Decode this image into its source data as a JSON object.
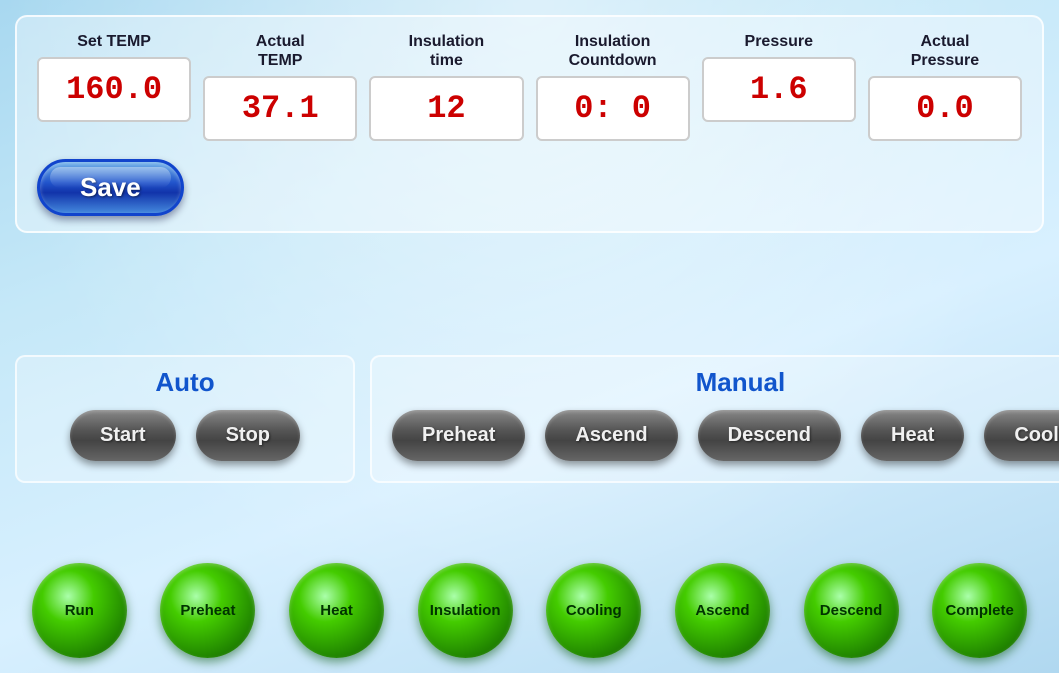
{
  "top_panel": {
    "fields": [
      {
        "label": "Set TEMP",
        "value": "160.0",
        "id": "set-temp"
      },
      {
        "label": "Actual\nTEMP",
        "value": "37.1",
        "id": "actual-temp"
      },
      {
        "label": "Insulation\ntime",
        "value": "12",
        "id": "insulation-time"
      },
      {
        "label": "Insulation\nCountdown",
        "value": "0:  0",
        "id": "insulation-countdown"
      },
      {
        "label": "Pressure",
        "value": "1.6",
        "id": "pressure"
      },
      {
        "label": "Actual\nPressure",
        "value": "0.0",
        "id": "actual-pressure"
      }
    ],
    "save_label": "Save"
  },
  "auto_panel": {
    "title": "Auto",
    "buttons": [
      {
        "label": "Start",
        "id": "start-btn"
      },
      {
        "label": "Stop",
        "id": "stop-btn"
      }
    ]
  },
  "manual_panel": {
    "title": "Manual",
    "buttons": [
      {
        "label": "Preheat",
        "id": "preheat-btn"
      },
      {
        "label": "Ascend",
        "id": "ascend-btn"
      },
      {
        "label": "Descend",
        "id": "descend-btn"
      },
      {
        "label": "Heat",
        "id": "heat-btn"
      },
      {
        "label": "Cool",
        "id": "cool-btn"
      }
    ]
  },
  "status_indicators": [
    {
      "label": "Run",
      "id": "run-indicator"
    },
    {
      "label": "Preheat",
      "id": "preheat-indicator"
    },
    {
      "label": "Heat",
      "id": "heat-indicator"
    },
    {
      "label": "Insulation",
      "id": "insulation-indicator"
    },
    {
      "label": "Cooling",
      "id": "cooling-indicator"
    },
    {
      "label": "Ascend",
      "id": "ascend-indicator"
    },
    {
      "label": "Descend",
      "id": "descend-indicator"
    },
    {
      "label": "Complete",
      "id": "complete-indicator"
    }
  ]
}
